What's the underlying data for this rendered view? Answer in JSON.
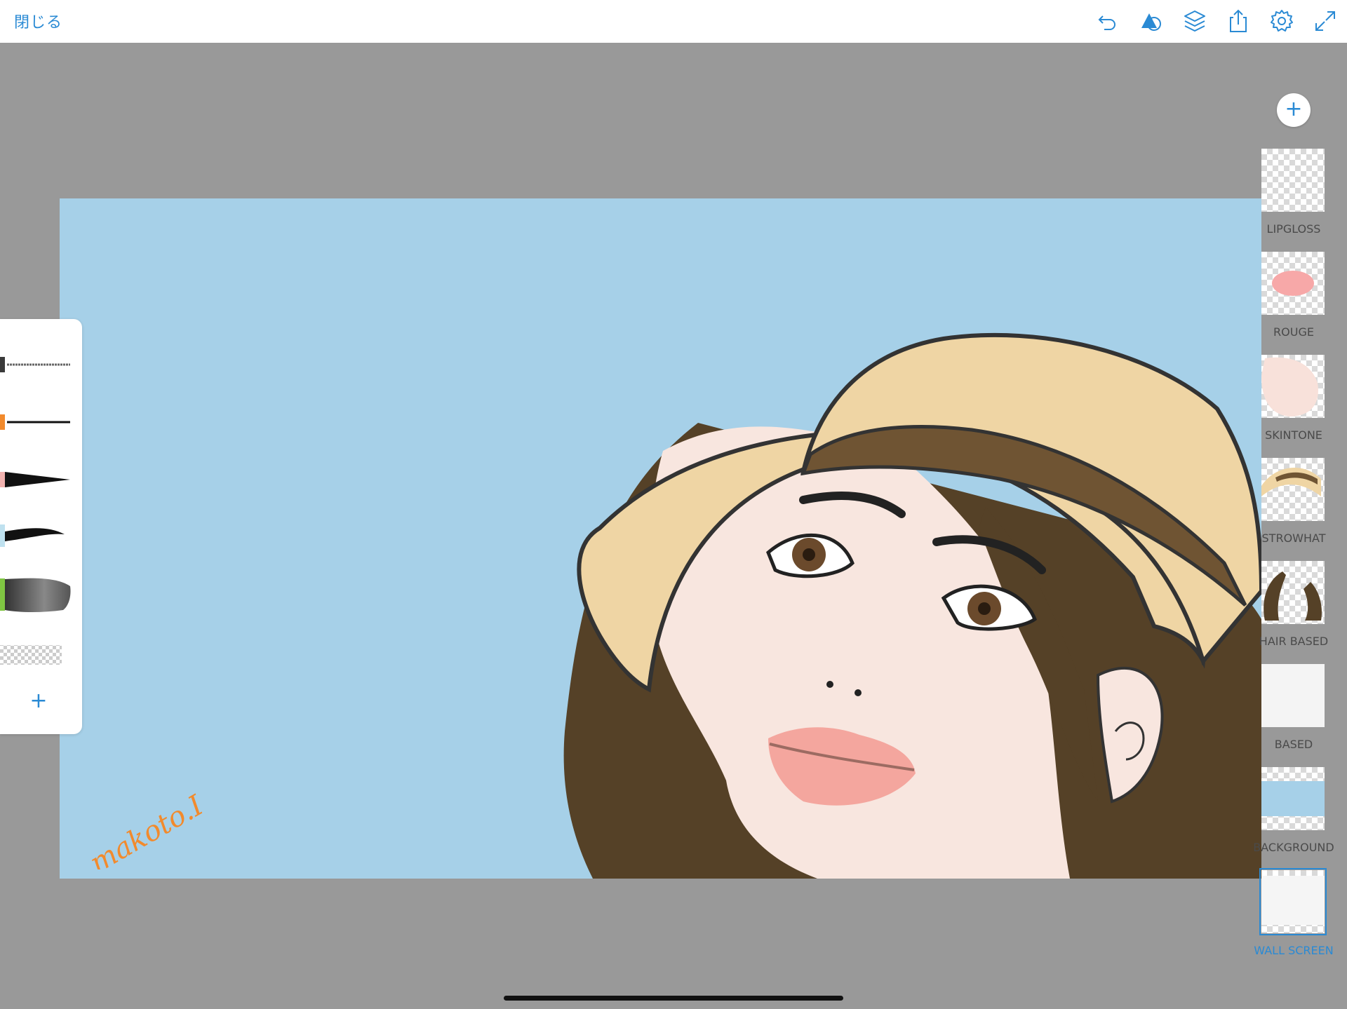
{
  "toolbar": {
    "close_label": "閉じる",
    "icons": [
      "undo-icon",
      "shapes-icon",
      "layers-icon",
      "share-icon",
      "settings-icon",
      "fullscreen-icon"
    ],
    "accent": "#2a8ad4"
  },
  "artwork": {
    "signature": "makoto.I",
    "background_color": "#a6d0e8"
  },
  "brushes": {
    "items": [
      "pen-brush",
      "line-brush",
      "taper-brush",
      "ink-brush",
      "wash-brush",
      "eraser-brush"
    ],
    "colors": [
      "#3a3a3a",
      "#f28a2c",
      "#f2b3b0",
      "#bfe1ef",
      "#7fc542",
      "#cccccc"
    ],
    "add_label": "+"
  },
  "layers": {
    "add_label": "+",
    "items": [
      {
        "label": "LIPGLOSS"
      },
      {
        "label": "ROUGE"
      },
      {
        "label": "SKINTONE"
      },
      {
        "label": "STROWHAT"
      },
      {
        "label": "HAIR BASED"
      },
      {
        "label": "BASED"
      },
      {
        "label": "BACKGROUND"
      },
      {
        "label": "WALL SCREEN"
      }
    ],
    "selected": "WALL SCREEN"
  }
}
